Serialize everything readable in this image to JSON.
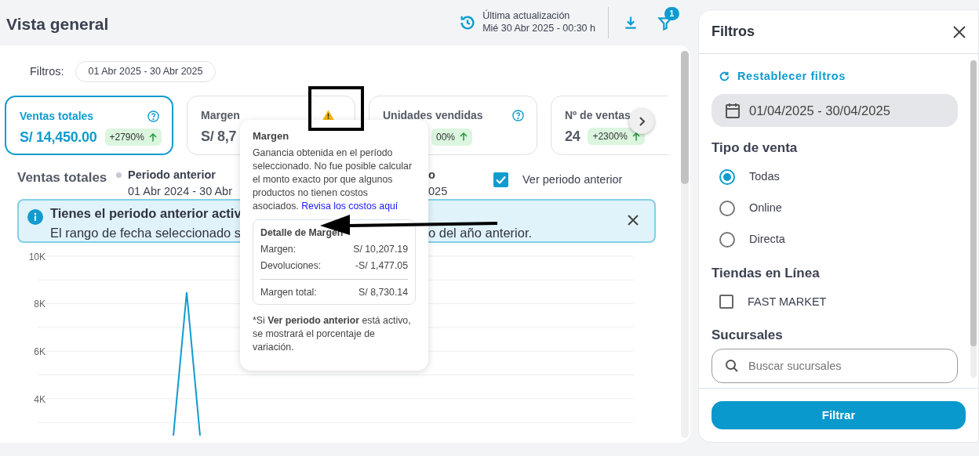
{
  "header": {
    "title": "Vista general",
    "update_label": "Última actualización",
    "update_value": "Mié 30 Abr 2025 - 00:30 h",
    "filter_badge": "1"
  },
  "filters_row": {
    "label": "Filtros:",
    "chip": "01 Abr 2025 - 30 Abr 2025"
  },
  "kpi_cards": [
    {
      "title": "Ventas totales",
      "value": "S/ 14,450.00",
      "change": "+2790%",
      "selected": true,
      "help": true
    },
    {
      "title": "Margen",
      "value": "S/ 8,7",
      "selected": false,
      "warning": true
    },
    {
      "title": "Unidades vendidas",
      "change": "00%",
      "selected": false,
      "help": true
    },
    {
      "title": "Nº de ventas",
      "value": "24",
      "change": "+2300%",
      "selected": false
    }
  ],
  "chart_header": {
    "title": "Ventas totales",
    "legend": [
      {
        "name": "Periodo anterior",
        "dates": "01 Abr 2024 - 30 Abr",
        "color": "#c7c9d3"
      },
      {
        "name": "o",
        "dates": "025"
      }
    ],
    "compare": {
      "label": "Ver periodo anterior",
      "checked": true
    }
  },
  "alert": {
    "title": "Tienes el periodo anterior activ",
    "message_parts": [
      "El rango de fecha seleccionado s",
      "o del año anterior."
    ]
  },
  "chart": {
    "kind": "picture",
    "y_ticks": [
      "10K",
      "8K",
      "6K",
      "4K"
    ]
  },
  "tooltip": {
    "title": "Margen",
    "description": "Ganancia obtenida en el período seleccionado. No fue posible calcular el monto exacto por que algunos productos no tienen costos asociados.",
    "link": "Revisa los costos aquí",
    "detail": {
      "title": "Detalle de Margen",
      "rows": [
        {
          "label": "Margen:",
          "value": "S/ 10,207.19"
        },
        {
          "label": "Devoluciones:",
          "value": "-S/ 1,477.05"
        }
      ],
      "total": {
        "label": "Margen total:",
        "value": "S/ 8,730.14"
      }
    },
    "note": "*Si **Ver periodo anterior** está activo, se mostrará el porcentaje de variación."
  },
  "annotations": [
    {
      "kind": "box"
    },
    {
      "kind": "arrow"
    }
  ],
  "filters_panel": {
    "title": "Filtros",
    "reset": "Restablecer filtros",
    "date_range": "01/04/2025 - 30/04/2025",
    "sections": [
      {
        "title": "Tipo de venta",
        "kind": "radio",
        "options": [
          {
            "label": "Todas",
            "selected": true
          },
          {
            "label": "Online",
            "selected": false
          },
          {
            "label": "Directa",
            "selected": false
          }
        ]
      },
      {
        "title": "Tiendas en Línea",
        "kind": "checkbox",
        "options": [
          {
            "label": "FAST MARKET",
            "checked": false
          }
        ]
      },
      {
        "title": "Sucursales",
        "kind": "search",
        "placeholder": "Buscar sucursales"
      }
    ],
    "submit": "Filtrar"
  }
}
